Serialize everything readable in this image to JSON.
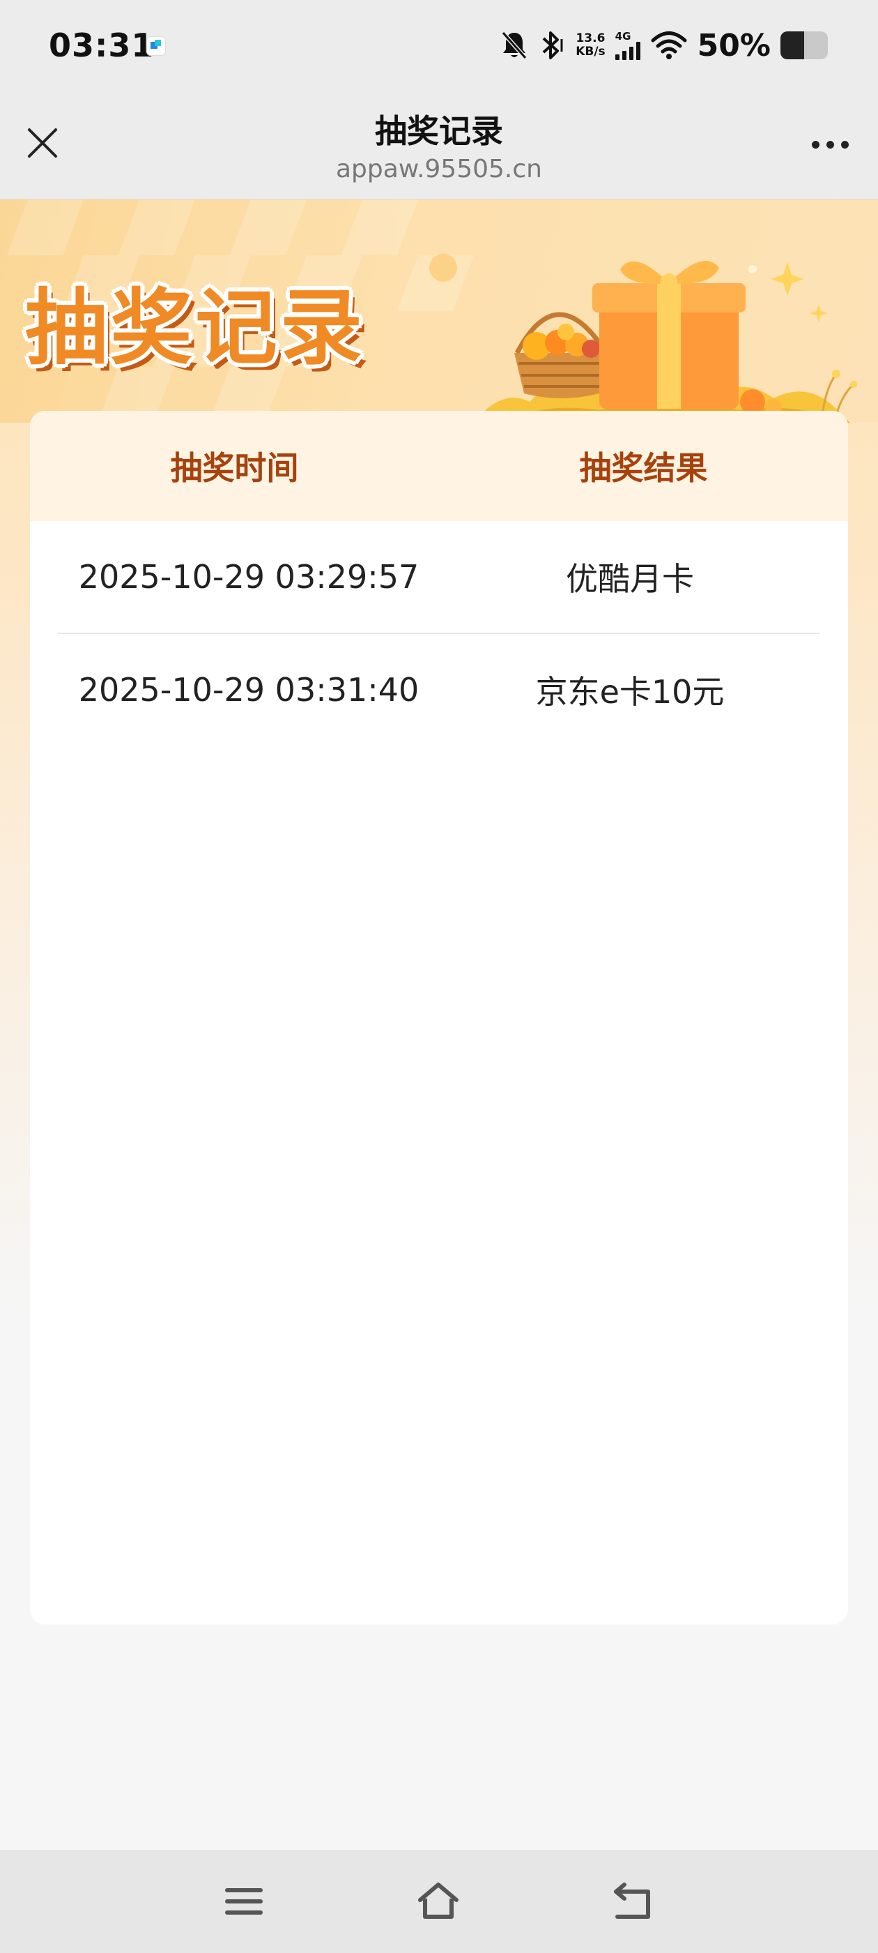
{
  "status_bar": {
    "time": "03:31",
    "net_speed_value": "13.6",
    "net_speed_unit": "KB/s",
    "network_type": "4G",
    "battery_percent": "50%",
    "battery_level": 0.5,
    "icons": [
      "app-notification-icon",
      "mute-icon",
      "bluetooth-icon",
      "signal-icon",
      "wifi-icon",
      "battery-icon"
    ]
  },
  "nav": {
    "title": "抽奖记录",
    "url": "appaw.95505.cn",
    "close_icon": "close-icon",
    "more_icon": "more-icon"
  },
  "banner": {
    "title": "抽奖记录"
  },
  "table": {
    "headers": [
      "抽奖时间",
      "抽奖结果"
    ],
    "rows": [
      {
        "time": "2025-10-29 03:29:57",
        "result": "优酷月卡"
      },
      {
        "time": "2025-10-29 03:31:40",
        "result": "京东e卡10元"
      }
    ]
  },
  "colors": {
    "header_text": "#a8420d",
    "banner_title": "#f08a24",
    "card_header_bg": "#fff4e3"
  },
  "system_nav": {
    "icons": [
      "menu-icon",
      "home-icon",
      "back-icon"
    ]
  }
}
